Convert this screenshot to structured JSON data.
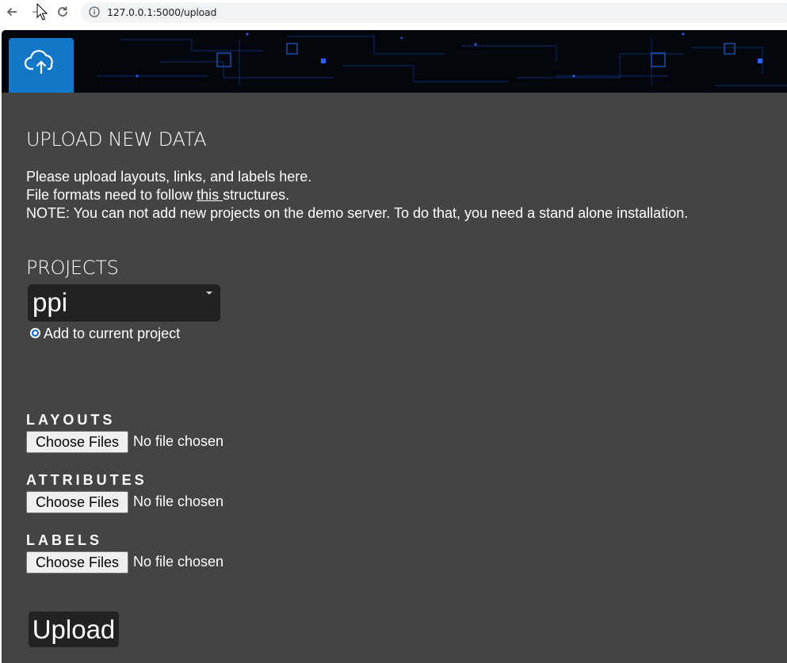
{
  "browser": {
    "url": "127.0.0.1:5000/upload"
  },
  "page": {
    "title": "UPLOAD NEW DATA",
    "intro_line1": "Please upload layouts, links, and labels here.",
    "intro_line2_before": "File formats need to follow ",
    "intro_line2_link": "this ",
    "intro_line2_after": "structures.",
    "intro_line3": "NOTE: You can not add new projects on the demo server. To do that, you need a stand alone installation."
  },
  "projects": {
    "title": "PROJECTS",
    "selected": "ppi",
    "radio_label": "Add to current project",
    "radio_checked": true
  },
  "files": {
    "layouts_label": "LAYOUTS",
    "attributes_label": "ATTRIBUTES",
    "labels_label": "LABELS",
    "choose_label": "Choose Files",
    "no_file_text": "No file chosen"
  },
  "actions": {
    "upload_label": "Upload"
  },
  "colors": {
    "accent": "#1377c8",
    "background": "#444444",
    "control_dark": "#222222",
    "banner": "#03060d"
  },
  "icons": {
    "tab": "cloud-upload-icon",
    "back": "arrow-left-icon",
    "forward": "arrow-right-icon",
    "reload": "reload-icon",
    "site_info": "info-icon"
  }
}
